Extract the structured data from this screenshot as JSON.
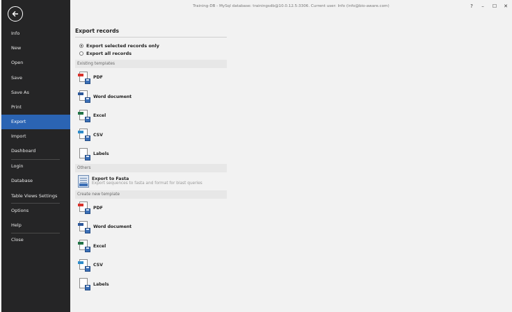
{
  "titlebar": {
    "text": "Training-DB - MySql database: trainingsdb@10.0.12.5:3306. Current user: Info (info@bio-aware.com)"
  },
  "window_controls": {
    "help": "?",
    "minimize": "–",
    "maximize": "☐",
    "close": "✕"
  },
  "sidebar": {
    "items": [
      {
        "label": "Info"
      },
      {
        "label": "New"
      },
      {
        "label": "Open"
      },
      {
        "label": "Save"
      },
      {
        "label": "Save As"
      },
      {
        "label": "Print"
      },
      {
        "label": "Export"
      },
      {
        "label": "Import"
      },
      {
        "label": "Dashboard"
      },
      {
        "label": "Login"
      },
      {
        "label": "Database"
      },
      {
        "label": "Table Views Settings"
      },
      {
        "label": "Options"
      },
      {
        "label": "Help"
      },
      {
        "label": "Close"
      }
    ],
    "selected": "Export"
  },
  "main": {
    "heading": "Export records",
    "radio_selected": "Export selected records only",
    "radio_all": "Export all records",
    "existing_header": "Existing templates",
    "existing": [
      {
        "label": "PDF",
        "icon": "pdf-icon",
        "color": "#d9322b"
      },
      {
        "label": "Word document",
        "icon": "word-icon",
        "color": "#2b579a"
      },
      {
        "label": "Excel",
        "icon": "excel-icon",
        "color": "#217346"
      },
      {
        "label": "CSV",
        "icon": "csv-icon",
        "color": "#2e8bc9"
      },
      {
        "label": "Labels",
        "icon": "labels-icon",
        "color": "#ffffff"
      }
    ],
    "others_header": "Others",
    "fasta_title": "Export to Fasta",
    "fasta_desc": "Export sequences to fasta and format for blast queries",
    "create_header": "Create new template",
    "create": [
      {
        "label": "PDF",
        "icon": "pdf-icon",
        "color": "#d9322b"
      },
      {
        "label": "Word document",
        "icon": "word-icon",
        "color": "#2b579a"
      },
      {
        "label": "Excel",
        "icon": "excel-icon",
        "color": "#217346"
      },
      {
        "label": "CSV",
        "icon": "csv-icon",
        "color": "#2e8bc9"
      },
      {
        "label": "Labels",
        "icon": "labels-icon",
        "color": "#ffffff"
      }
    ]
  },
  "colors": {
    "sidebar_bg": "#252526",
    "accent": "#2b64b3",
    "content_bg": "#f2f2f2"
  }
}
